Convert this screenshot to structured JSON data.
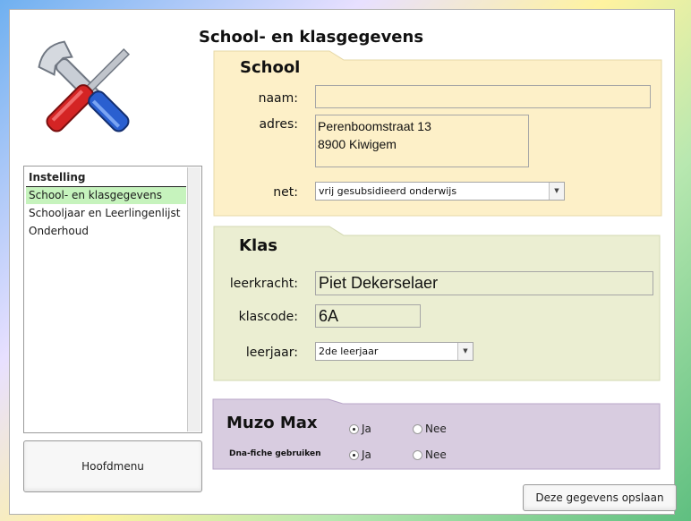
{
  "page_title": "School- en klasgegevens",
  "logo": {
    "icon": "tools-icon"
  },
  "sidebar": {
    "header": "Instelling",
    "items": [
      {
        "label": "School- en klasgegevens",
        "selected": true
      },
      {
        "label": "Schooljaar en Leerlingenlijst",
        "selected": false
      },
      {
        "label": "Onderhoud",
        "selected": false
      }
    ],
    "menu_button": "Hoofdmenu"
  },
  "school": {
    "title": "School",
    "naam_label": "naam:",
    "naam_value": "",
    "adres_label": "adres:",
    "adres_line1": "Perenboomstraat 13",
    "adres_line2": "8900 Kiwigem",
    "net_label": "net:",
    "net_value": "vrij gesubsidieerd onderwijs"
  },
  "klas": {
    "title": "Klas",
    "leerkracht_label": "leerkracht:",
    "leerkracht_value": "Piet Dekerselaer",
    "klascode_label": "klascode:",
    "klascode_value": "6A",
    "leerjaar_label": "leerjaar:",
    "leerjaar_value": "2de leerjaar"
  },
  "muzo": {
    "title": "Muzo Max",
    "row2_label": "Dna-fiche gebruiken",
    "ja_label": "Ja",
    "nee_label": "Nee",
    "row1_selected": "Ja",
    "row2_selected": "Ja"
  },
  "save_button": "Deze gegevens opslaan",
  "colors": {
    "school_panel": "#fdf0c8",
    "klas_panel": "#ebeed2",
    "muzo_panel": "#d8cce0",
    "selected_item": "#c6f3bd"
  }
}
